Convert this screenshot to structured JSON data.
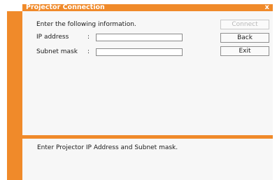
{
  "window": {
    "title": "Projector Connection",
    "close_glyph": "x"
  },
  "form": {
    "prompt": "Enter the following information.",
    "ip_label": "IP address",
    "ip_colon": ":",
    "ip_value": "",
    "subnet_label": "Subnet mask",
    "subnet_colon": ":",
    "subnet_value": ""
  },
  "buttons": {
    "connect": "Connect",
    "connect_enabled": false,
    "back": "Back",
    "exit": "Exit"
  },
  "status": {
    "message": "Enter Projector IP Address and Subnet mask."
  },
  "colors": {
    "accent": "#f08a2a",
    "panel": "#f7f7f7"
  },
  "icons": {
    "close": "close-icon"
  }
}
